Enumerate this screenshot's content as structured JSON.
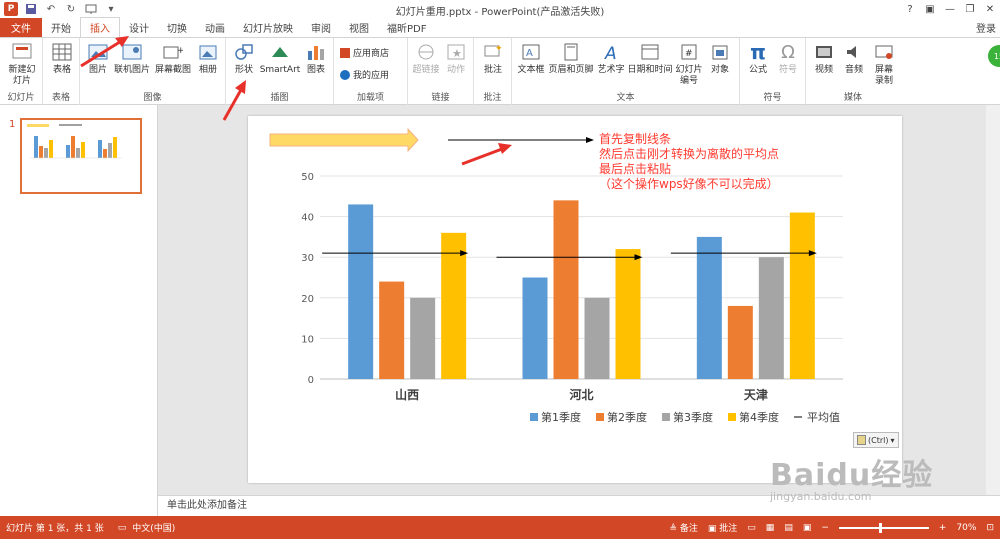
{
  "window": {
    "title": "幻灯片重用.pptx - PowerPoint(产品激活失败)",
    "help": "?",
    "login": "登录"
  },
  "tabs": [
    "文件",
    "开始",
    "插入",
    "设计",
    "切换",
    "动画",
    "幻灯片放映",
    "审阅",
    "视图",
    "福昕PDF"
  ],
  "active_tab": "插入",
  "ribbon": {
    "groups": {
      "slides": "幻灯片",
      "tables": "表格",
      "images": "图像",
      "illustrations": "插图",
      "addins": "加载项",
      "links": "链接",
      "comments": "批注",
      "text": "文本",
      "symbols": "符号",
      "media": "媒体"
    },
    "buttons": {
      "new_slide": "新建幻灯片",
      "table": "表格",
      "picture": "图片",
      "online_picture": "联机图片",
      "screenshot": "屏幕截图",
      "album": "相册",
      "shapes": "形状",
      "smartart": "SmartArt",
      "chart": "图表",
      "app_store": "应用商店",
      "my_apps": "我的应用",
      "hyperlink": "超链接",
      "action": "动作",
      "comment": "批注",
      "textbox": "文本框",
      "header_footer": "页眉和页脚",
      "wordart": "艺术字",
      "datetime": "日期和时间",
      "slide_number": "幻灯片编号",
      "object": "对象",
      "equation": "公式",
      "symbol": "符号",
      "video": "视频",
      "audio": "音频",
      "screen_recording": "屏幕录制"
    },
    "badge": "15"
  },
  "thumbnail": {
    "number": "1"
  },
  "slide": {
    "annotation_lines": [
      "首先复制线条",
      "然后点击刚才转换为离散的平均点",
      "最后点击粘贴",
      "（这个操作wps好像不可以完成）"
    ],
    "ctrl_label": "(Ctrl)"
  },
  "chart_data": {
    "type": "bar",
    "categories": [
      "山西",
      "河北",
      "天津"
    ],
    "series": [
      {
        "name": "第1季度",
        "values": [
          43,
          25,
          35
        ],
        "color": "#5b9bd5"
      },
      {
        "name": "第2季度",
        "values": [
          24,
          44,
          18
        ],
        "color": "#ed7d31"
      },
      {
        "name": "第3季度",
        "values": [
          20,
          20,
          30
        ],
        "color": "#a5a5a5"
      },
      {
        "name": "第4季度",
        "values": [
          36,
          32,
          41
        ],
        "color": "#ffc000"
      }
    ],
    "average_series": {
      "name": "平均值",
      "values": [
        31,
        30,
        31
      ]
    },
    "yticks": [
      0,
      10,
      20,
      30,
      40,
      50
    ],
    "ylim": [
      0,
      50
    ],
    "legend": "bottom",
    "grid": true
  },
  "notes": {
    "placeholder": "单击此处添加备注"
  },
  "status": {
    "slide_info": "幻灯片 第 1 张，共 1 张",
    "language": "中文(中国)",
    "notes_btn": "备注",
    "comments_btn": "批注",
    "zoom": "70%"
  },
  "watermark": {
    "brand": "Baidu经验",
    "url": "jingyan.baidu.com"
  },
  "colors": {
    "accent": "#d24726",
    "arrow_red": "#e8302a"
  }
}
